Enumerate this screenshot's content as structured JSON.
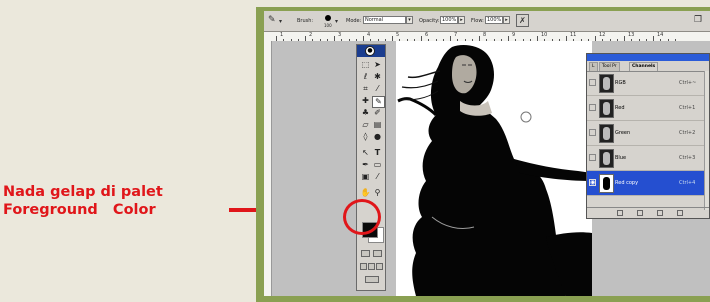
{
  "annotation": {
    "line1": "Nada gelap di palet",
    "line2": "Foreground   Color"
  },
  "options_bar": {
    "brush_label": "Brush:",
    "brush_size": "100",
    "mode_label": "Mode:",
    "mode_value": "Normal",
    "opacity_label": "Opacity:",
    "opacity_value": "100%",
    "flow_label": "Flow:",
    "flow_value": "100%"
  },
  "ruler": {
    "numbers": [
      "1",
      "2",
      "3",
      "4",
      "5",
      "6",
      "7",
      "8",
      "9",
      "10",
      "11",
      "12",
      "13",
      "14"
    ]
  },
  "channels_palette": {
    "tabs": [
      "L",
      "Tool Pr",
      "Channels"
    ],
    "active_tab": "Channels",
    "rows": [
      {
        "name": "RGB",
        "shortcut": "Ctrl+~"
      },
      {
        "name": "Red",
        "shortcut": "Ctrl+1"
      },
      {
        "name": "Green",
        "shortcut": "Ctrl+2"
      },
      {
        "name": "Blue",
        "shortcut": "Ctrl+3"
      },
      {
        "name": "Red copy",
        "shortcut": "Ctrl+4"
      }
    ]
  },
  "colors": {
    "callout_red": "#e0161a",
    "frame_green": "#8aa052",
    "foreground_color": "#0a0a0a",
    "background_color": "#ffffff",
    "selected_channel": "#254fd0"
  }
}
